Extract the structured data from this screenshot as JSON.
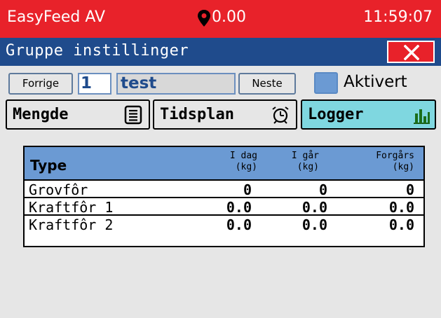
{
  "titlebar": {
    "app_title": "EasyFeed AV",
    "location_value": "0.00",
    "clock": "11:59:07"
  },
  "header": {
    "title": "Gruppe instillinger",
    "close_icon": "close-icon"
  },
  "nav": {
    "prev_label": "Forrige",
    "group_number": "1",
    "group_name": "test",
    "next_label": "Neste",
    "active_label": "Aktivert"
  },
  "tabs": [
    {
      "label": "Mengde",
      "icon": "list-icon"
    },
    {
      "label": "Tidsplan",
      "icon": "alarm-clock-icon"
    },
    {
      "label": "Logger",
      "icon": "bar-chart-icon",
      "active": true
    }
  ],
  "table": {
    "headers": {
      "type": "Type",
      "today": [
        "I dag",
        "(kg)"
      ],
      "yesterday": [
        "I går",
        "(kg)"
      ],
      "day_before": [
        "Forgårs",
        "(kg)"
      ]
    },
    "rows": [
      {
        "type": "Grovfôr",
        "today": "0",
        "yesterday": "0",
        "day_before": "0"
      },
      {
        "type": "Kraftfôr 1",
        "today": "0.0",
        "yesterday": "0.0",
        "day_before": "0.0"
      },
      {
        "type": "Kraftfôr 2",
        "today": "0.0",
        "yesterday": "0.0",
        "day_before": "0.0"
      }
    ]
  },
  "colors": {
    "title_red": "#e8222a",
    "header_blue": "#1f4b8c",
    "accent_blue": "#6b9ad3",
    "active_tab": "#7fd7e0"
  }
}
